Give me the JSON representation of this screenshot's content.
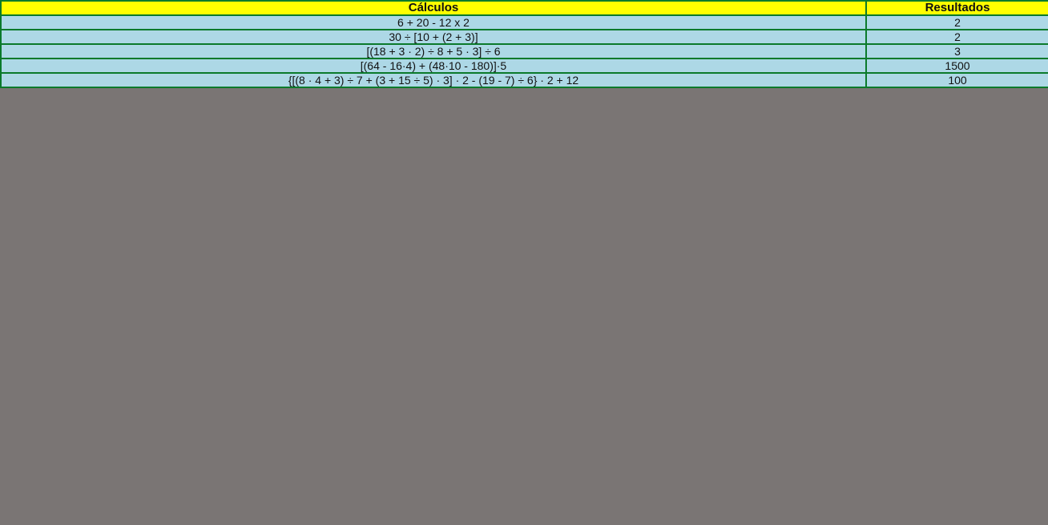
{
  "table": {
    "headers": {
      "calculos": "Cálculos",
      "resultados": "Resultados"
    },
    "rows": [
      {
        "calculo": "6 + 20 - 12 x 2",
        "resultado": "2"
      },
      {
        "calculo": "30 ÷ [10 + (2 + 3)]",
        "resultado": "2"
      },
      {
        "calculo": "[(18 + 3 · 2) ÷ 8 + 5 · 3] ÷ 6",
        "resultado": "3"
      },
      {
        "calculo": "[(64 - 16·4) + (48·10 - 180)]·5",
        "resultado": "1500"
      },
      {
        "calculo": "{[(8 · 4 + 3) ÷ 7 + (3 + 15 ÷ 5) · 3] · 2 - (19 - 7) ÷ 6} · 2 + 12",
        "resultado": "100"
      }
    ]
  },
  "colors": {
    "header_background": "#ffff00",
    "cell_background": "#add8e6",
    "border": "#0b7a2b",
    "page_background": "#7a7574"
  }
}
